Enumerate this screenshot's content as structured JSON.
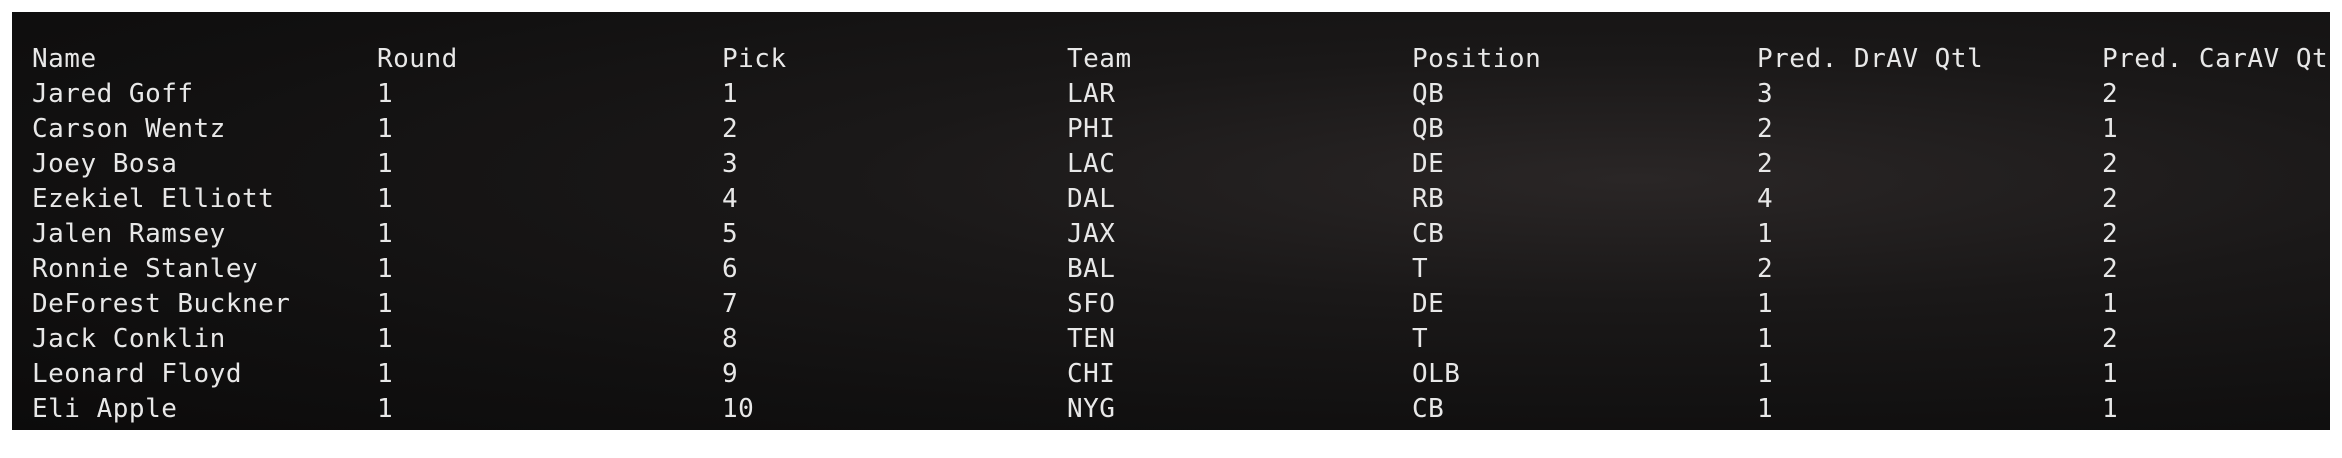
{
  "table": {
    "columns": [
      "Name",
      "Round",
      "Pick",
      "Team",
      "Position",
      "Pred. DrAV Qtl",
      "Pred. CarAV Qtl"
    ],
    "rows": [
      [
        "Jared Goff",
        "1",
        "1",
        "LAR",
        "QB",
        "3",
        "2"
      ],
      [
        "Carson Wentz",
        "1",
        "2",
        "PHI",
        "QB",
        "2",
        "1"
      ],
      [
        "Joey Bosa",
        "1",
        "3",
        "LAC",
        "DE",
        "2",
        "2"
      ],
      [
        "Ezekiel Elliott",
        "1",
        "4",
        "DAL",
        "RB",
        "4",
        "2"
      ],
      [
        "Jalen Ramsey",
        "1",
        "5",
        "JAX",
        "CB",
        "1",
        "2"
      ],
      [
        "Ronnie Stanley",
        "1",
        "6",
        "BAL",
        "T",
        "2",
        "2"
      ],
      [
        "DeForest Buckner",
        "1",
        "7",
        "SFO",
        "DE",
        "1",
        "1"
      ],
      [
        "Jack Conklin",
        "1",
        "8",
        "TEN",
        "T",
        "1",
        "2"
      ],
      [
        "Leonard Floyd",
        "1",
        "9",
        "CHI",
        "OLB",
        "1",
        "1"
      ],
      [
        "Eli Apple",
        "1",
        "10",
        "NYG",
        "CB",
        "1",
        "1"
      ]
    ]
  }
}
